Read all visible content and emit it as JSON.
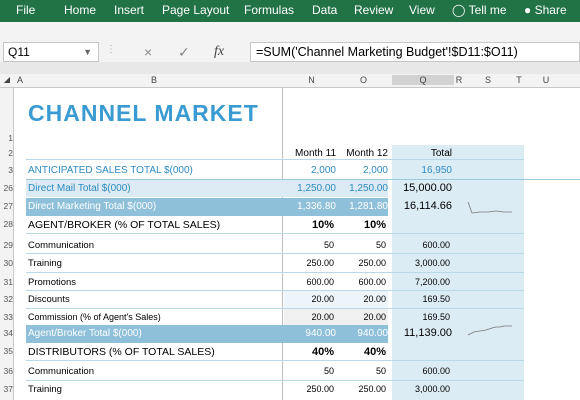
{
  "ribbon": {
    "tabs": [
      "File",
      "Home",
      "Insert",
      "Page Layout",
      "Formulas",
      "Data",
      "Review",
      "View",
      "Tell me",
      "Share"
    ],
    "color": "#217346"
  },
  "formula_bar": {
    "name_box": "Q11",
    "cancel_icon": "×",
    "enter_icon": "✓",
    "fx_icon": "fx",
    "formula": "=SUM('Channel Marketing Budget'!$D11:$O11)"
  },
  "columns": [
    "A",
    "B",
    "N",
    "O",
    "Q",
    "R",
    "S",
    "T",
    "U"
  ],
  "rows": [
    "1",
    "2",
    "3",
    "26",
    "27",
    "28",
    "29",
    "30",
    "31",
    "32",
    "33",
    "34",
    "35",
    "36",
    "37"
  ],
  "sheet": {
    "title": "CHANNEL MARKET",
    "headers": {
      "m11": "Month 11",
      "m12": "Month 12",
      "total": "Total"
    },
    "lines": [
      {
        "label": "ANTICIPATED SALES TOTAL $(000)",
        "m11": "2,000",
        "m12": "2,000",
        "total": "16,950"
      },
      {
        "label": "Direct Mail Total $(000)",
        "m11": "1,250.00",
        "m12": "1,250.00",
        "total": "15,000.00"
      },
      {
        "label": "Direct Marketing Total $(000)",
        "m11": "1,336.80",
        "m12": "1,281.80",
        "total": "16,114.66"
      },
      {
        "label": "AGENT/BROKER (% OF TOTAL SALES)",
        "m11": "10%",
        "m12": "10%",
        "total": ""
      },
      {
        "label": "Communication",
        "m11": "50",
        "m12": "50",
        "total": "600.00"
      },
      {
        "label": "Training",
        "m11": "250.00",
        "m12": "250.00",
        "total": "3,000.00"
      },
      {
        "label": "Promotions",
        "m11": "600.00",
        "m12": "600.00",
        "total": "7,200.00"
      },
      {
        "label": "Discounts",
        "m11": "20.00",
        "m12": "20.00",
        "total": "169.50"
      },
      {
        "label": "Commission (% of Agent's Sales)",
        "m11": "20.00",
        "m12": "20.00",
        "total": "169.50"
      },
      {
        "label": "Agent/Broker Total $(000)",
        "m11": "940.00",
        "m12": "940.00",
        "total": "11,139.00"
      },
      {
        "label": "DISTRIBUTORS (% OF TOTAL SALES)",
        "m11": "40%",
        "m12": "40%",
        "total": ""
      },
      {
        "label": "Communication",
        "m11": "50",
        "m12": "50",
        "total": "600.00"
      },
      {
        "label": "Training",
        "m11": "250.00",
        "m12": "250.00",
        "total": "3,000.00"
      }
    ],
    "colors": {
      "accent": "#3a9bd3",
      "band_dark": "#8fc0da",
      "band_light": "#dbeaf3",
      "total_col": "#dcecf5"
    }
  }
}
